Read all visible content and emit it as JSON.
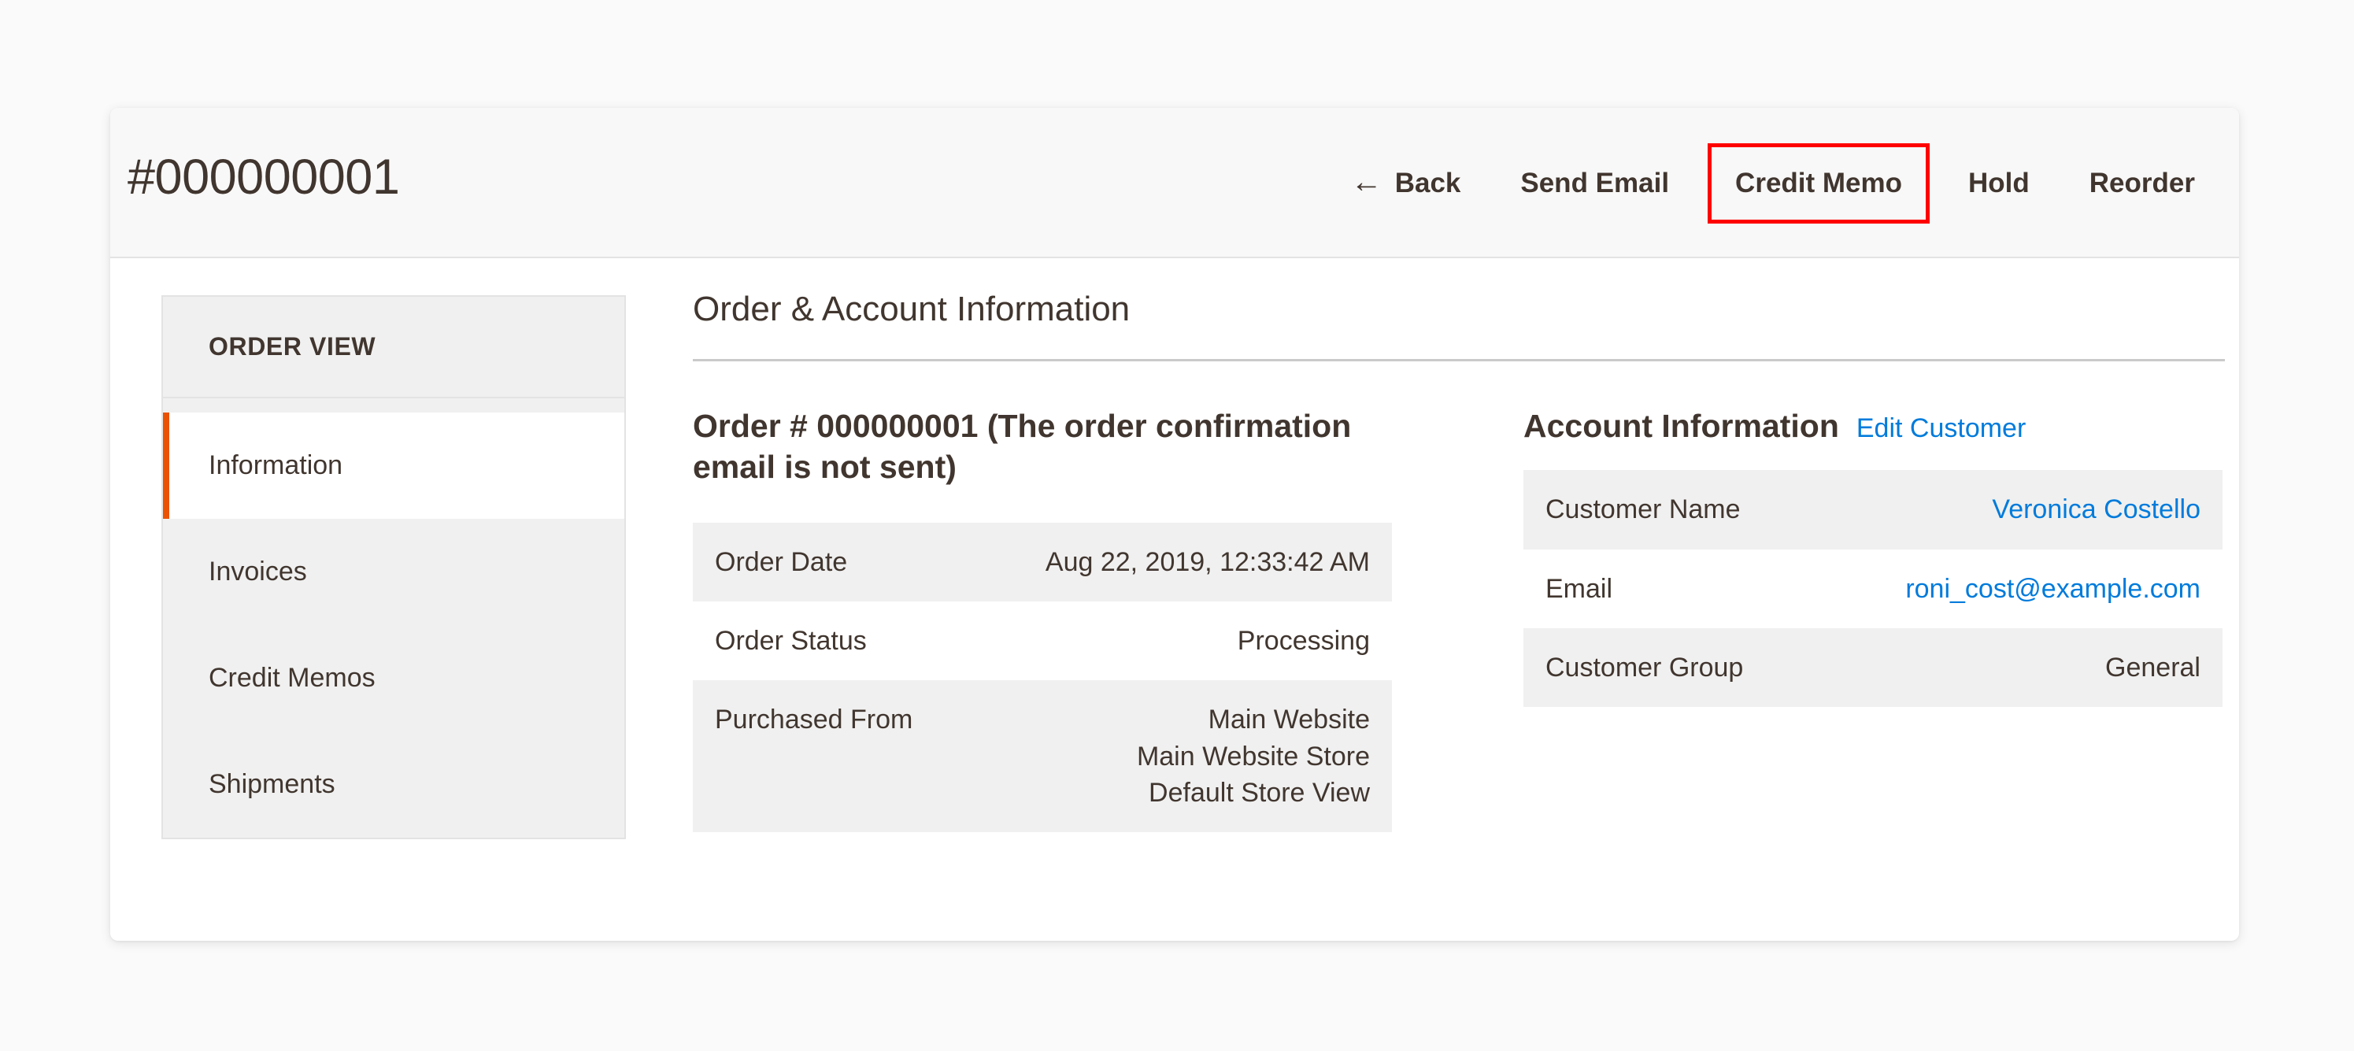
{
  "header": {
    "title": "#000000001",
    "actions": [
      {
        "label": "Back",
        "icon": "arrow-left-icon",
        "glyph": "←",
        "name": "back-button",
        "highlighted": false
      },
      {
        "label": "Send Email",
        "icon": null,
        "glyph": "",
        "name": "send-email-button",
        "highlighted": false
      },
      {
        "label": "Credit Memo",
        "icon": null,
        "glyph": "",
        "name": "credit-memo-button",
        "highlighted": true
      },
      {
        "label": "Hold",
        "icon": null,
        "glyph": "",
        "name": "hold-button",
        "highlighted": false
      },
      {
        "label": "Reorder",
        "icon": null,
        "glyph": "",
        "name": "reorder-button",
        "highlighted": false
      }
    ],
    "highlight_color": "#ff0000"
  },
  "sidebar": {
    "title": "ORDER VIEW",
    "active_accent_color": "#eb5202",
    "items": [
      {
        "label": "Information",
        "active": true
      },
      {
        "label": "Invoices",
        "active": false
      },
      {
        "label": "Credit Memos",
        "active": false
      },
      {
        "label": "Shipments",
        "active": false
      }
    ]
  },
  "main": {
    "section_title": "Order & Account Information",
    "order": {
      "heading": "Order # 000000001 (The order confirmation email is not sent)",
      "rows": [
        {
          "label": "Order Date",
          "value": "Aug 22, 2019, 12:33:42 AM",
          "shaded": true
        },
        {
          "label": "Order Status",
          "value": "Processing",
          "shaded": false
        },
        {
          "label": "Purchased From",
          "value": "Main Website\nMain Website Store\nDefault Store View",
          "shaded": true
        }
      ]
    },
    "account": {
      "heading": "Account Information",
      "edit_link": "Edit Customer",
      "link_color": "#007bdb",
      "rows": [
        {
          "label": "Customer Name",
          "value": "Veronica Costello",
          "is_link": true,
          "shaded": true
        },
        {
          "label": "Email",
          "value": "roni_cost@example.com",
          "is_link": true,
          "shaded": false
        },
        {
          "label": "Customer Group",
          "value": "General",
          "is_link": false,
          "shaded": true
        }
      ]
    }
  }
}
